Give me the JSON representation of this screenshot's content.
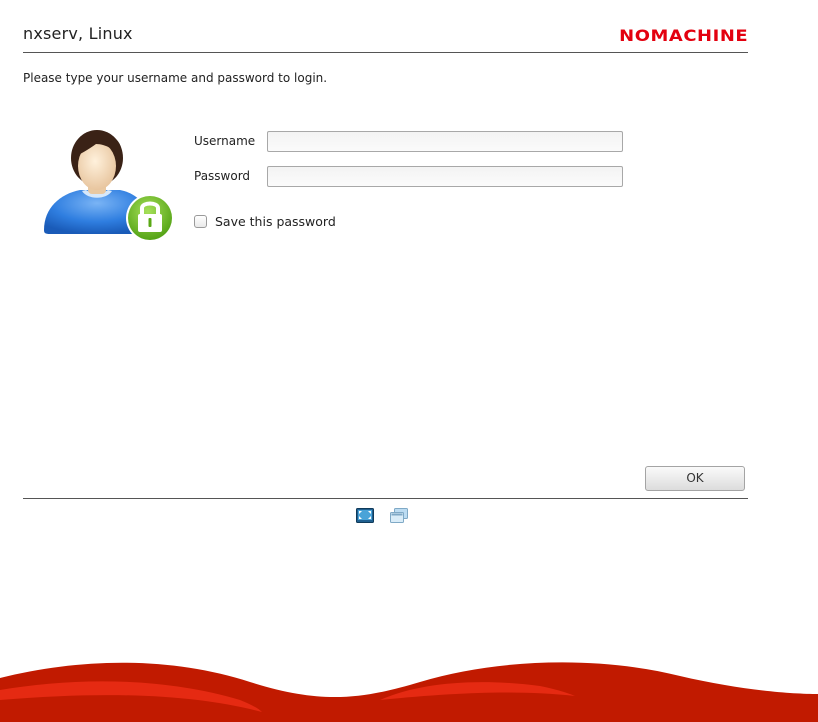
{
  "header": {
    "server_title": "nxserv, Linux",
    "brand": "NOMACHINE",
    "brand_color": "#e3000f"
  },
  "instruction": "Please type your username and password to login.",
  "avatar": {
    "icon": "user-locked-icon",
    "lock_color": "#6cbf1e"
  },
  "form": {
    "username_label": "Username",
    "username_value": "",
    "password_label": "Password",
    "password_value": "",
    "save_password_label": "Save this password",
    "save_password_checked": false
  },
  "ok_label": "OK",
  "footer": {
    "icons": [
      "fullscreen-icon",
      "windows-icon"
    ]
  },
  "theme": {
    "wave_color": "#c11a00",
    "wave_highlight": "#e52a12"
  }
}
